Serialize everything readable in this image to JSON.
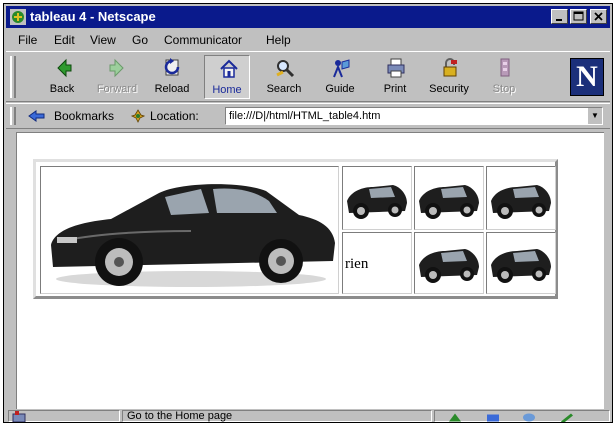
{
  "window": {
    "title": "tableau 4 - Netscape"
  },
  "menu": [
    "File",
    "Edit",
    "View",
    "Go",
    "Communicator",
    "Help"
  ],
  "toolbar": {
    "buttons": [
      {
        "label": "Back",
        "icon": "back-arrow-icon"
      },
      {
        "label": "Forward",
        "icon": "forward-arrow-icon",
        "disabled": true
      },
      {
        "label": "Reload",
        "icon": "reload-icon"
      },
      {
        "label": "Home",
        "icon": "home-icon",
        "pressed": true
      },
      {
        "label": "Search",
        "icon": "search-icon"
      },
      {
        "label": "Guide",
        "icon": "guide-icon"
      },
      {
        "label": "Print",
        "icon": "print-icon"
      },
      {
        "label": "Security",
        "icon": "security-lock-icon"
      },
      {
        "label": "Stop",
        "icon": "stop-icon",
        "disabled": true
      }
    ],
    "logo": "N"
  },
  "location": {
    "bookmarks_label": "Bookmarks",
    "location_label": "Location:",
    "url": "file:///D|/html/HTML_table4.htm"
  },
  "content": {
    "table_text": "rien"
  },
  "status": {
    "text": "Go to the Home page"
  },
  "colors": {
    "titlebar": "#0a1a8c",
    "chrome": "#c0c0c0",
    "netscape_logo": "#1b2f7a"
  }
}
